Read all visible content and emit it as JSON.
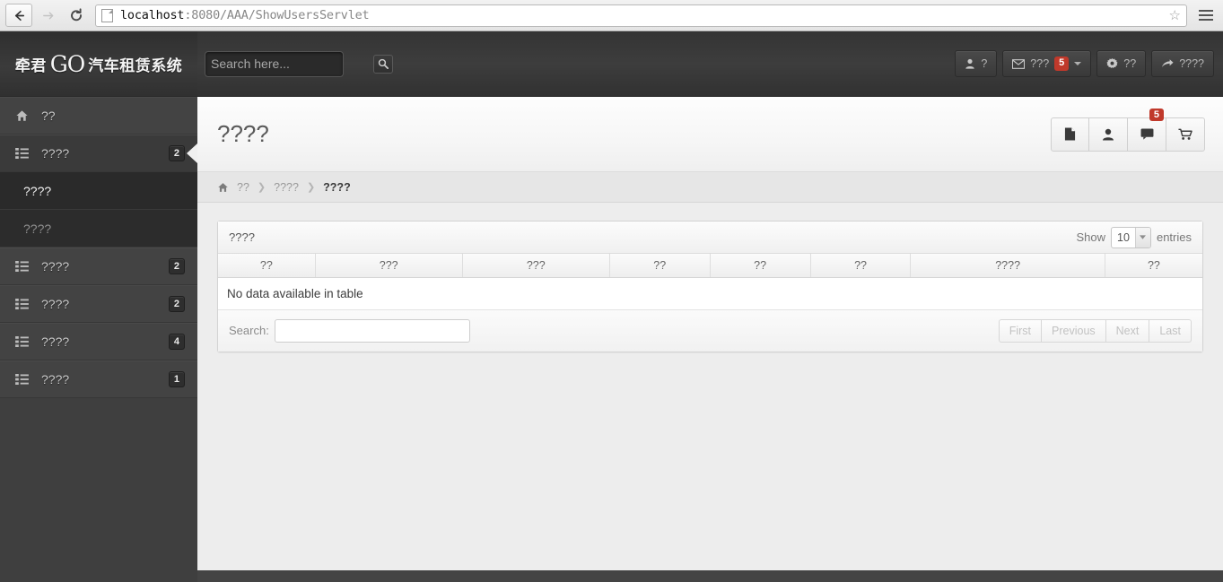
{
  "browser": {
    "back_icon": "arrow-left",
    "forward_icon": "arrow-right",
    "reload_icon": "reload",
    "url_host": "localhost",
    "url_path": ":8080/AAA/ShowUsersServlet",
    "star_icon": "☆",
    "menu_icon": "hamburger"
  },
  "sidebar": {
    "brand": {
      "left": "牵君",
      "go": "GO",
      "right": "汽车租赁系统"
    },
    "items": [
      {
        "label": "??",
        "icon": "home-icon",
        "badge": "",
        "active": false,
        "submenu": []
      },
      {
        "label": "????",
        "icon": "list-icon",
        "badge": "2",
        "active": true,
        "submenu": [
          {
            "label": "????",
            "current": true
          },
          {
            "label": "????",
            "current": false
          }
        ]
      },
      {
        "label": "????",
        "icon": "list-icon",
        "badge": "2",
        "active": false,
        "submenu": []
      },
      {
        "label": "????",
        "icon": "list-icon",
        "badge": "2",
        "active": false,
        "submenu": []
      },
      {
        "label": "????",
        "icon": "list-icon",
        "badge": "4",
        "active": false,
        "submenu": []
      },
      {
        "label": "????",
        "icon": "list-icon",
        "badge": "1",
        "active": false,
        "submenu": []
      }
    ]
  },
  "topbar": {
    "search": {
      "value": "",
      "placeholder": "Search here...",
      "button_icon": "search-icon"
    },
    "nav": [
      {
        "icon": "user-icon",
        "label": "?",
        "badge": "",
        "caret": false
      },
      {
        "icon": "envelope-icon",
        "label": "???",
        "badge": "5",
        "caret": true
      },
      {
        "icon": "gear-icon",
        "label": "??",
        "badge": "",
        "caret": false
      },
      {
        "icon": "logout-icon",
        "label": "????",
        "badge": "",
        "caret": false
      }
    ]
  },
  "page": {
    "title": "????",
    "head_buttons": [
      {
        "icon": "document-icon",
        "badge": ""
      },
      {
        "icon": "user-icon",
        "badge": ""
      },
      {
        "icon": "comment-icon",
        "badge": "5"
      },
      {
        "icon": "cart-icon",
        "badge": ""
      }
    ],
    "breadcrumb": [
      {
        "label": "??",
        "home": true,
        "active": false
      },
      {
        "label": "????",
        "home": false,
        "active": false
      },
      {
        "label": "????",
        "home": false,
        "active": true
      }
    ],
    "breadcrumb_separator": "❯"
  },
  "panel": {
    "title": "????",
    "length": {
      "show_label": "Show",
      "value": "10",
      "entries_label": "entries"
    },
    "columns": [
      "??",
      "???",
      "???",
      "??",
      "??",
      "??",
      "????",
      "??"
    ],
    "rows": [],
    "empty_text": "No data available in table",
    "search": {
      "label": "Search:",
      "value": "",
      "placeholder": ""
    },
    "pagination": [
      "First",
      "Previous",
      "Next",
      "Last"
    ]
  }
}
